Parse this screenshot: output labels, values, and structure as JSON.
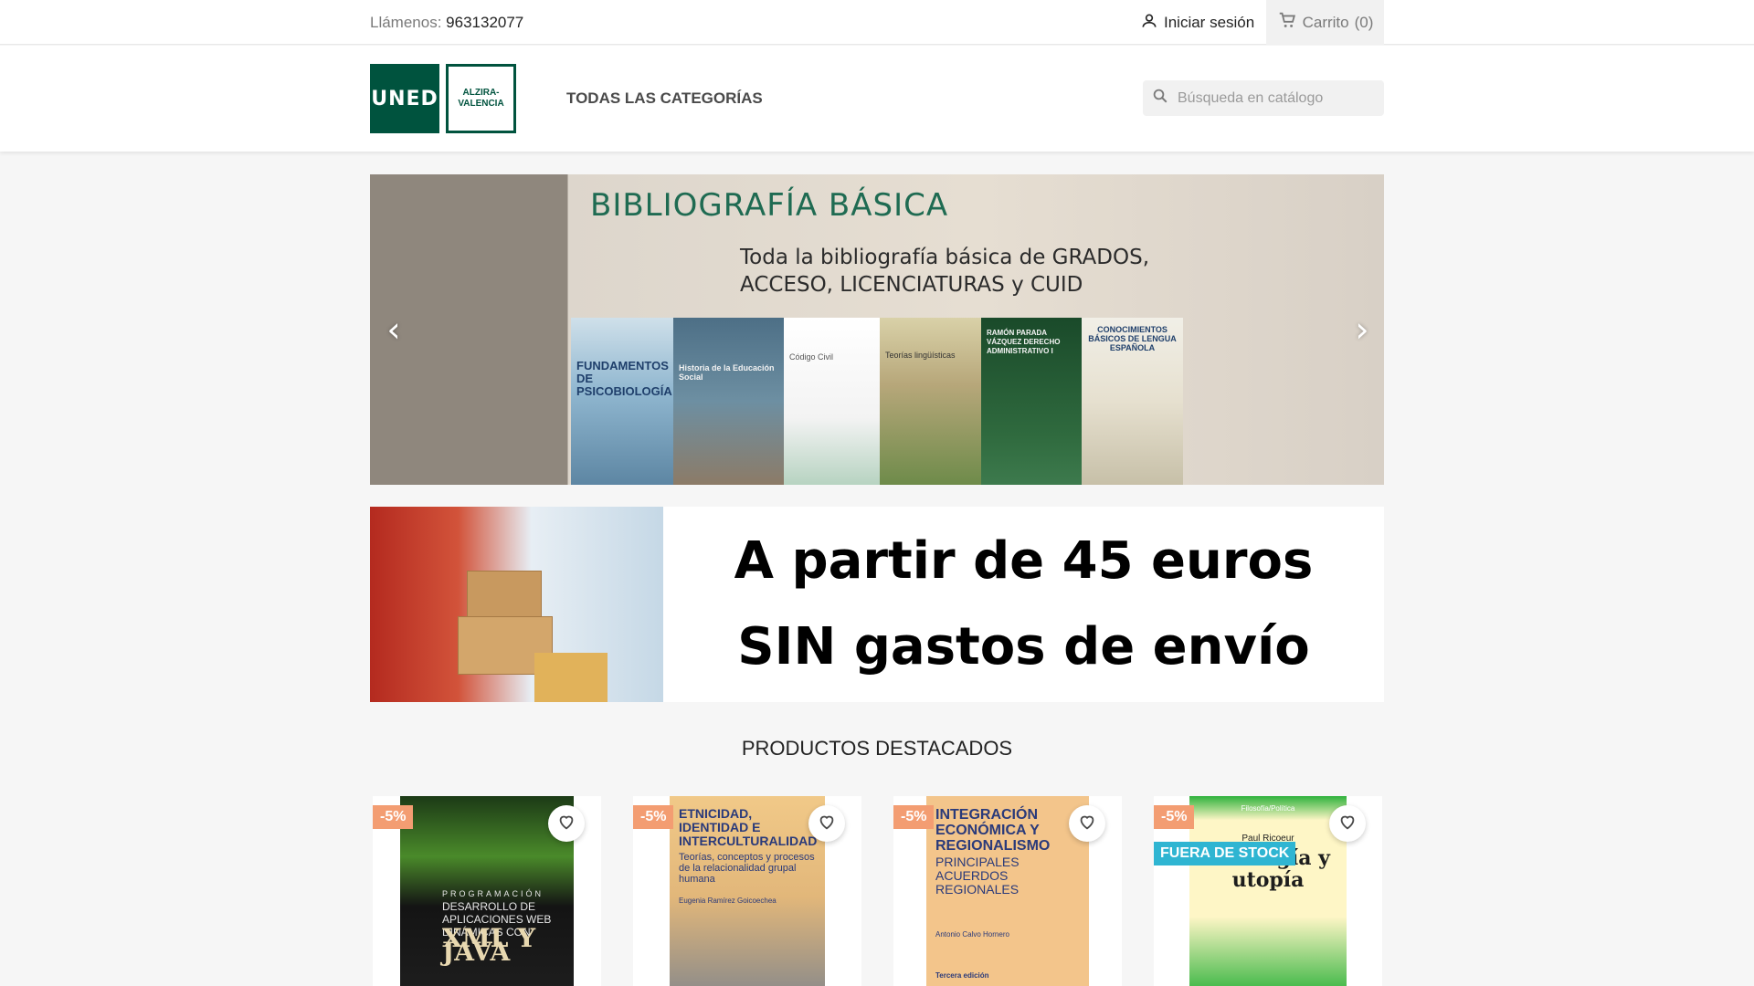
{
  "topbar": {
    "call_label": "Llámenos:",
    "phone": "963132077",
    "signin_label": "Iniciar sesión",
    "cart_label": "Carrito",
    "cart_count": "(0)"
  },
  "header": {
    "logo_text": "UNED",
    "logo_center_line1": "ALZIRA-",
    "logo_center_line2": "VALENCIA",
    "nav_categories": "TODAS LAS CATEGORÍAS",
    "search_placeholder": "Búsqueda en catálogo"
  },
  "slider": {
    "title": "BIBLIOGRAFÍA BÁSICA",
    "subtitle_line1": "Toda la bibliografía básica de GRADOS,",
    "subtitle_line2": "ACCESO, LICENCIATURAS y CUID",
    "books": [
      "FUNDAMENTOS DE PSICOBIOLOGÍA",
      "Historia de la Educación Social",
      "Código Civil",
      "Teorías lingüísticas",
      "RAMÓN PARADA VÁZQUEZ DERECHO ADMINISTRATIVO I",
      "CONOCIMIENTOS BÁSICOS DE LENGUA ESPAÑOLA"
    ]
  },
  "promo": {
    "line1": "A partir de 45 euros",
    "line2": "SIN gastos de envío"
  },
  "featured": {
    "title": "PRODUCTOS DESTACADOS",
    "products": [
      {
        "discount": "-5%",
        "cover_series": "PROGRAMACIÓN",
        "cover_title": "DESARROLLO DE APLICACIONES WEB DINÁMICAS CON",
        "cover_big": "XML Y JAVA"
      },
      {
        "discount": "-5%",
        "cover_title": "ETNICIDAD, IDENTIDAD E INTERCULTURALIDAD",
        "cover_subtitle": "Teorías, conceptos y procesos de la relacionalidad grupal humana",
        "cover_author": "Eugenia Ramírez Goicoechea"
      },
      {
        "discount": "-5%",
        "cover_title": "INTEGRACIÓN ECONÓMICA Y REGIONALISMO",
        "cover_subtitle": "PRINCIPALES ACUERDOS REGIONALES",
        "cover_author": "Antonio Calvo Hornero",
        "cover_edition": "Tercera edición"
      },
      {
        "discount": "-5%",
        "stock_label": "FUERA DE STOCK",
        "cover_kicker": "Filosofía/Política",
        "cover_author": "Paul Ricoeur",
        "cover_title": "Ideología y utopía"
      }
    ]
  },
  "colors": {
    "brand_green": "#00533e",
    "discount_bg": "#f39d72",
    "stock_bg": "#2fb5d2",
    "page_bg": "#f6f6f6"
  }
}
